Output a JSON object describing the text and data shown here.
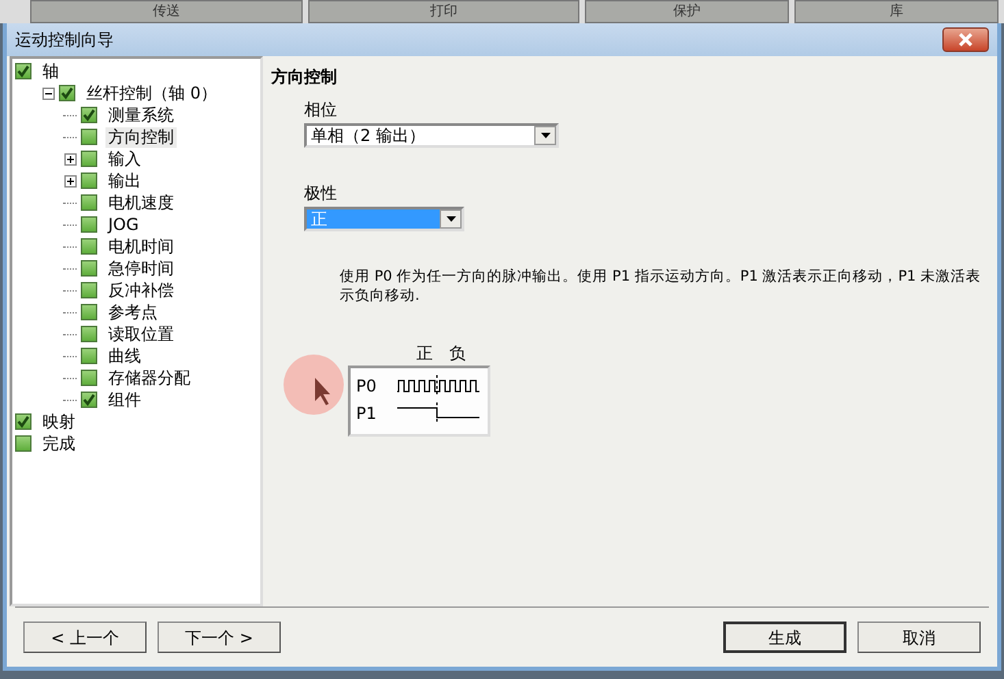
{
  "background_tabs": [
    "传送",
    "打印",
    "保护",
    "库"
  ],
  "window": {
    "title": "运动控制向导"
  },
  "tree": [
    {
      "label": "轴",
      "checked": true,
      "selected": false,
      "children": [
        {
          "label": "丝杆控制（轴 0）",
          "checked": true,
          "selected": false,
          "expanded": true,
          "children": [
            {
              "label": "测量系统",
              "checked": true,
              "selected": false
            },
            {
              "label": "方向控制",
              "checked": false,
              "selected": true
            },
            {
              "label": "输入",
              "checked": false,
              "selected": false,
              "expanded": false
            },
            {
              "label": "输出",
              "checked": false,
              "selected": false,
              "expanded": false
            },
            {
              "label": "电机速度",
              "checked": false,
              "selected": false
            },
            {
              "label": "JOG",
              "checked": false,
              "selected": false
            },
            {
              "label": "电机时间",
              "checked": false,
              "selected": false
            },
            {
              "label": "急停时间",
              "checked": false,
              "selected": false
            },
            {
              "label": "反冲补偿",
              "checked": false,
              "selected": false
            },
            {
              "label": "参考点",
              "checked": false,
              "selected": false
            },
            {
              "label": "读取位置",
              "checked": false,
              "selected": false
            },
            {
              "label": "曲线",
              "checked": false,
              "selected": false
            },
            {
              "label": "存储器分配",
              "checked": false,
              "selected": false
            },
            {
              "label": "组件",
              "checked": true,
              "selected": false
            }
          ]
        }
      ]
    },
    {
      "label": "映射",
      "checked": true,
      "selected": false
    },
    {
      "label": "完成",
      "checked": false,
      "selected": false
    }
  ],
  "page": {
    "heading": "方向控制",
    "fields": [
      {
        "label": "相位",
        "value": "单相（2 输出）",
        "focused": false
      },
      {
        "label": "极性",
        "value": "正",
        "focused": true
      }
    ],
    "description": "使用 P0 作为任一方向的脉冲输出。使用 P1 指示运动方向。P1 激活表示正向移动，P1 未激活表示负向移动.",
    "diagram": {
      "directions": [
        "正",
        "负"
      ],
      "signals": [
        {
          "name": "P0",
          "kind": "pulse"
        },
        {
          "name": "P1",
          "kind": "step"
        }
      ]
    }
  },
  "buttons": [
    {
      "label": "< 上一个",
      "default": false
    },
    {
      "label": "下一个 >",
      "default": false
    },
    {
      "label": "生成",
      "default": true
    },
    {
      "label": "取消",
      "default": false
    }
  ]
}
